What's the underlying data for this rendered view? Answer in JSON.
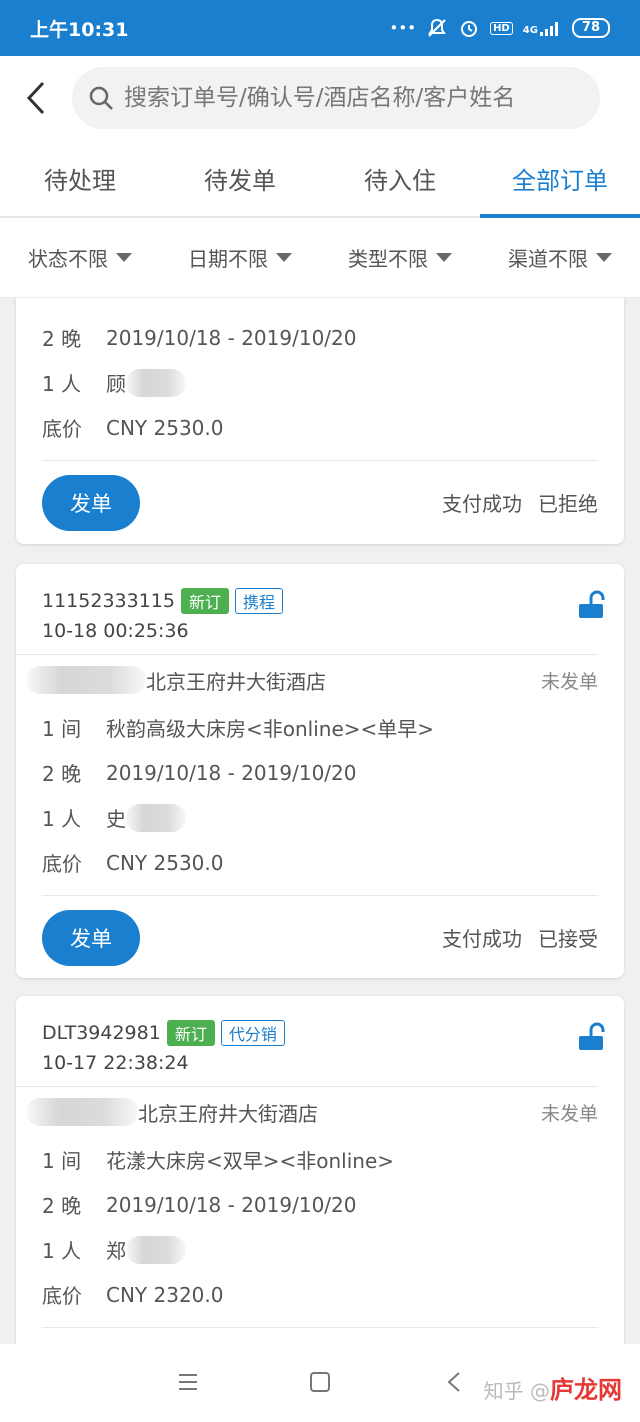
{
  "statusbar": {
    "time": "上午10:31",
    "dots": "•••",
    "hd": "HD",
    "network": "4G",
    "battery": "78"
  },
  "search": {
    "placeholder": "搜索订单号/确认号/酒店名称/客户姓名"
  },
  "tabs": [
    {
      "label": "待处理"
    },
    {
      "label": "待发单"
    },
    {
      "label": "待入住"
    },
    {
      "label": "全部订单"
    }
  ],
  "filters": [
    {
      "label": "状态不限"
    },
    {
      "label": "日期不限"
    },
    {
      "label": "类型不限"
    },
    {
      "label": "渠道不限"
    }
  ],
  "orders": [
    {
      "nights_k": "2 晚",
      "dates": "2019/10/18 - 2019/10/20",
      "people_k": "1 人",
      "guest": "顾",
      "price_k": "底价",
      "price": "CNY 2530.0",
      "send_label": "发单",
      "pay_status": "支付成功",
      "accept_status": "已拒绝"
    },
    {
      "order_no": "11152333115",
      "tag_new": "新订",
      "channel": "携程",
      "time": "10-18 00:25:36",
      "hotel": "北京王府井大街酒店",
      "dispatch": "未发单",
      "rooms_k": "1 间",
      "room": "秋韵高级大床房<非online><单早>",
      "nights_k": "2 晚",
      "dates": "2019/10/18 - 2019/10/20",
      "people_k": "1 人",
      "guest": "史",
      "price_k": "底价",
      "price": "CNY 2530.0",
      "send_label": "发单",
      "pay_status": "支付成功",
      "accept_status": "已接受"
    },
    {
      "order_no": "DLT3942981",
      "tag_new": "新订",
      "channel": "代分销",
      "time": "10-17 22:38:24",
      "hotel": "北京王府井大街酒店",
      "dispatch": "未发单",
      "rooms_k": "1 间",
      "room": "花漾大床房<双早><非online>",
      "nights_k": "2 晚",
      "dates": "2019/10/18 - 2019/10/20",
      "people_k": "1 人",
      "guest": "郑",
      "price_k": "底价",
      "price": "CNY 2320.0"
    }
  ],
  "watermark": {
    "prefix": "知乎 @",
    "site": "庐龙网"
  },
  "colors": {
    "primary": "#1b7fd0",
    "tag_green": "#4caf50"
  }
}
